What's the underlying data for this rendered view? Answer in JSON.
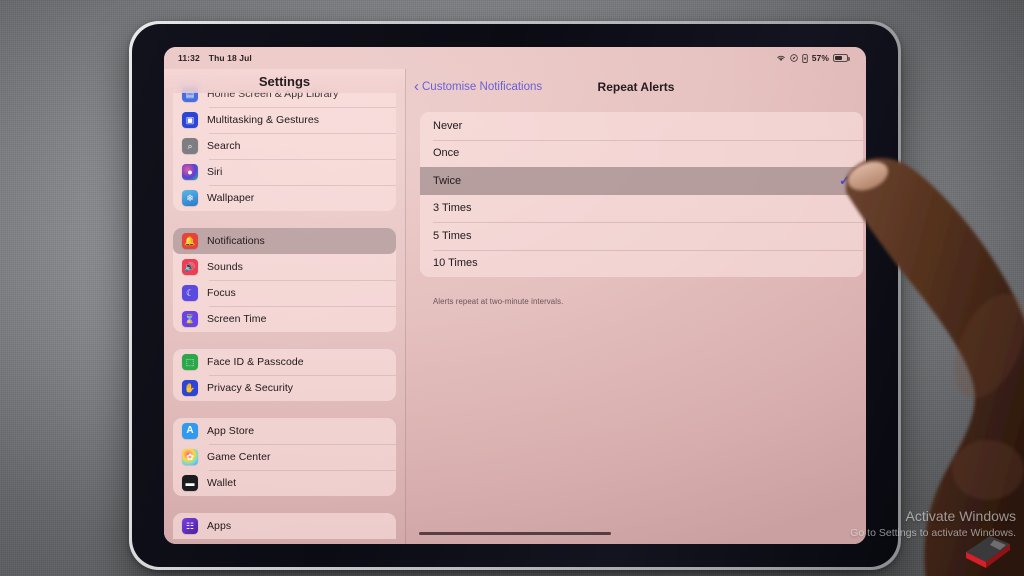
{
  "status_bar": {
    "time": "11:32",
    "date": "Thu 18 Jul",
    "wifi_icon": "wifi-icon",
    "location_icon": "location-icon",
    "lock_icon": "lock-portrait-icon",
    "battery_percent": "57%",
    "battery_icon": "battery-icon"
  },
  "sidebar": {
    "title": "Settings",
    "groups": [
      {
        "clip": "top",
        "items": [
          {
            "label": "Home Screen & App Library",
            "icon": "home-screen-icon",
            "icon_color": "#2f5fe0",
            "glyph": "▤",
            "selected": false,
            "clipped": true
          },
          {
            "label": "Multitasking & Gestures",
            "icon": "multitasking-icon",
            "icon_color": "#2b45d8",
            "glyph": "▣",
            "selected": false
          },
          {
            "label": "Search",
            "icon": "search-icon",
            "icon_color": "#7d7d82",
            "glyph": "⌕",
            "selected": false
          },
          {
            "label": "Siri",
            "icon": "siri-icon",
            "icon_color": "#1b1b2b",
            "glyph": "●",
            "selected": false
          },
          {
            "label": "Wallpaper",
            "icon": "wallpaper-icon",
            "icon_color": "#2e8fd6",
            "glyph": "❄",
            "selected": false
          }
        ]
      },
      {
        "items": [
          {
            "label": "Notifications",
            "icon": "notifications-bell-icon",
            "icon_color": "#e8433a",
            "glyph": "🔔",
            "selected": true
          },
          {
            "label": "Sounds",
            "icon": "sounds-speaker-icon",
            "icon_color": "#ef3d54",
            "glyph": "🔊",
            "selected": false
          },
          {
            "label": "Focus",
            "icon": "focus-moon-icon",
            "icon_color": "#5b4ae0",
            "glyph": "☾",
            "selected": false
          },
          {
            "label": "Screen Time",
            "icon": "screen-time-hourglass-icon",
            "icon_color": "#6a42e8",
            "glyph": "⌛",
            "selected": false
          }
        ]
      },
      {
        "items": [
          {
            "label": "Face ID & Passcode",
            "icon": "face-id-icon",
            "icon_color": "#2aa84a",
            "glyph": "⬚",
            "selected": false
          },
          {
            "label": "Privacy & Security",
            "icon": "privacy-hand-icon",
            "icon_color": "#2b45d8",
            "glyph": "✋",
            "selected": false
          }
        ]
      },
      {
        "items": [
          {
            "label": "App Store",
            "icon": "app-store-icon",
            "icon_color": "#2e9bf0",
            "glyph": "A",
            "selected": false
          },
          {
            "label": "Game Center",
            "icon": "game-center-icon",
            "icon_color": "#f0f0f0",
            "glyph": "✿",
            "selected": false
          },
          {
            "label": "Wallet",
            "icon": "wallet-icon",
            "icon_color": "#1c1c1e",
            "glyph": "▬",
            "selected": false
          }
        ]
      },
      {
        "clip": "bottom",
        "items": [
          {
            "label": "Apps",
            "icon": "apps-grid-icon",
            "icon_color": "#5b2fb0",
            "glyph": "☷",
            "selected": false
          }
        ]
      }
    ]
  },
  "detail": {
    "back_label": "Customise Notifications",
    "back_icon": "chevron-left-icon",
    "title": "Repeat Alerts",
    "options": [
      {
        "label": "Never",
        "selected": false
      },
      {
        "label": "Once",
        "selected": false
      },
      {
        "label": "Twice",
        "selected": true
      },
      {
        "label": "3 Times",
        "selected": false
      },
      {
        "label": "5 Times",
        "selected": false
      },
      {
        "label": "10 Times",
        "selected": false
      }
    ],
    "check_icon": "checkmark-icon",
    "footer": "Alerts repeat at two-minute intervals."
  },
  "watermark": {
    "title": "Activate Windows",
    "subtitle": "Go to Settings to activate Windows."
  },
  "colors": {
    "accent_blue": "#6a5fd6",
    "checkmark": "#4b45cf",
    "selected_row": "#7d696c",
    "screen_pink": "#e9c2c0",
    "wall_gray": "#8e9094"
  }
}
